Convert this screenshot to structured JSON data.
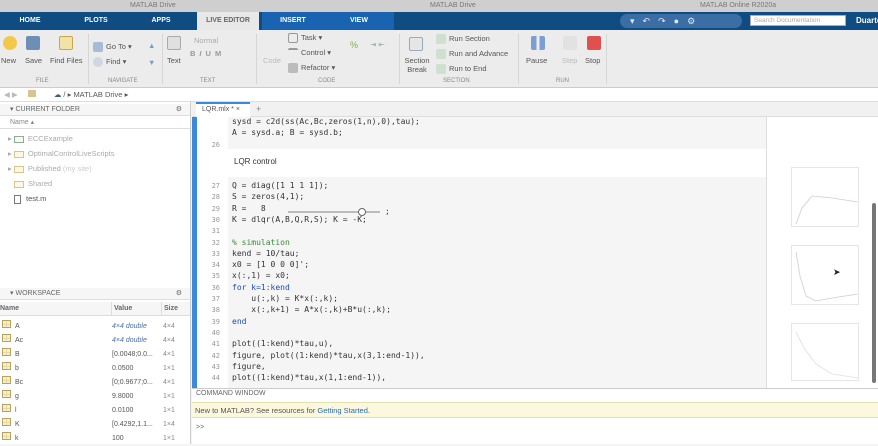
{
  "browser_tabs": [
    "MATLAB Drive",
    "MATLAB Drive",
    "MATLAB Online R2020a"
  ],
  "main_tabs": [
    "HOME",
    "PLOTS",
    "APPS",
    "LIVE EDITOR",
    "INSERT",
    "VIEW"
  ],
  "active_tab": "LIVE EDITOR",
  "search_placeholder": "Search Documentation",
  "user": "Duarte",
  "ribbon": {
    "file": {
      "label": "FILE",
      "new": "New",
      "save": "Save",
      "find_files": "Find Files"
    },
    "navigate": {
      "label": "NAVIGATE",
      "goto": "Go To",
      "find": "Find"
    },
    "text": {
      "label": "TEXT",
      "text": "Text",
      "style": "Normal",
      "bold": "B",
      "italic": "I",
      "underline": "U",
      "mono": "M"
    },
    "code": {
      "label": "CODE",
      "code": "Code",
      "task": "Task",
      "control": "Control",
      "refactor": "Refactor"
    },
    "section": {
      "label": "SECTION",
      "break": "Section Break",
      "run_section": "Run Section",
      "run_advance": "Run and Advance",
      "run_end": "Run to End"
    },
    "run": {
      "label": "RUN",
      "pause": "Pause",
      "step": "Step",
      "stop": "Stop"
    }
  },
  "address": {
    "sep": "/",
    "path": "MATLAB Drive"
  },
  "current_folder": {
    "title": "CURRENT FOLDER",
    "col": "Name",
    "items": [
      "ECCExample",
      "OptimalControlLiveScripts",
      "Published",
      "Shared",
      "test.m"
    ],
    "published_note": "(my site)"
  },
  "workspace": {
    "title": "WORKSPACE",
    "cols": [
      "Name",
      "Value",
      "Size"
    ],
    "rows": [
      [
        "A",
        "4×4 double",
        "4×4"
      ],
      [
        "Ac",
        "4×4 double",
        "4×4"
      ],
      [
        "B",
        "[0.0048;0.0...",
        "4×1"
      ],
      [
        "b",
        "0.0500",
        "1×1"
      ],
      [
        "Bc",
        "[0;0.9677;0...",
        "4×1"
      ],
      [
        "g",
        "9.8000",
        "1×1"
      ],
      [
        "l",
        "0.0100",
        "1×1"
      ],
      [
        "K",
        "[0.4292,1.1...",
        "1×4"
      ],
      [
        "k",
        "100",
        "1×1"
      ]
    ]
  },
  "editor": {
    "tab": "LQR.mlx *",
    "add": "+",
    "top_lines": [
      {
        "n": "",
        "t": "sysd = c2d(ss(Ac,Bc,zeros(1,n),0),tau);"
      },
      {
        "n": "",
        "t": "A = sysd.a; B = sysd.b;"
      },
      {
        "n": "26",
        "t": ""
      }
    ],
    "section_text": "LQR control",
    "lines": [
      {
        "n": "27",
        "t": "Q = diag([1 1 1 1]);"
      },
      {
        "n": "28",
        "t": "S = zeros(4,1);"
      },
      {
        "n": "29",
        "t": "R =   8"
      },
      {
        "n": "30",
        "t": "K = dlqr(A,B,Q,R,S); K = -K;"
      },
      {
        "n": "31",
        "t": ""
      },
      {
        "n": "32",
        "t": "% simulation"
      },
      {
        "n": "33",
        "t": "kend = 10/tau;"
      },
      {
        "n": "34",
        "t": "x0 = [1 0 0 0]';"
      },
      {
        "n": "35",
        "t": "x(:,1) = x0;"
      },
      {
        "n": "36",
        "t": "for k=1:kend"
      },
      {
        "n": "37",
        "t": "    u(:,k) = K*x(:,k);"
      },
      {
        "n": "38",
        "t": "    x(:,k+1) = A*x(:,k)+B*u(:,k);"
      },
      {
        "n": "39",
        "t": "end"
      },
      {
        "n": "40",
        "t": ""
      },
      {
        "n": "41",
        "t": "plot((1:kend)*tau,u),"
      },
      {
        "n": "42",
        "t": "figure, plot((1:kend)*tau,x(3,1:end-1)),"
      },
      {
        "n": "43",
        "t": "figure,"
      },
      {
        "n": "44",
        "t": "plot((1:kend)*tau,x(1,1:end-1)),"
      }
    ],
    "slider_end": ";",
    "slider_value_fraction": 0.8
  },
  "command_window": {
    "title": "COMMAND WINDOW",
    "notice_prefix": "New to MATLAB? See resources for ",
    "notice_link": "Getting Started",
    "notice_suffix": ".",
    "prompt": ">>"
  }
}
